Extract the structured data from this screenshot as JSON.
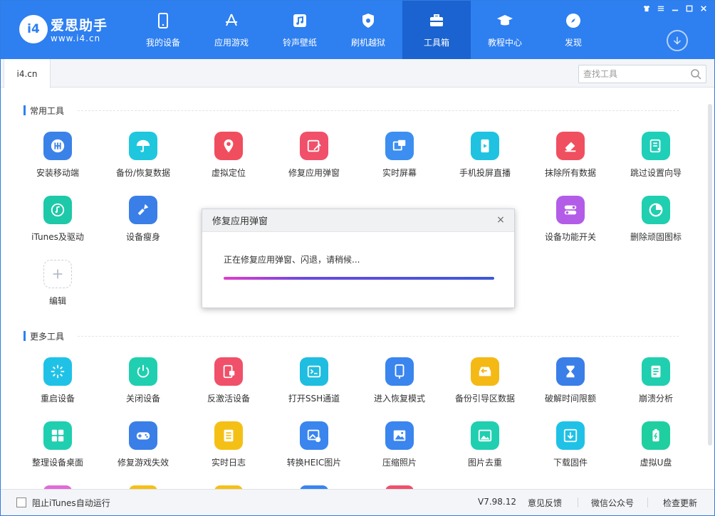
{
  "header": {
    "logo_text": "i4",
    "brand": "爱思助手",
    "url": "www.i4.cn",
    "nav": [
      {
        "label": "我的设备",
        "icon": "phone-icon"
      },
      {
        "label": "应用游戏",
        "icon": "appstore-icon"
      },
      {
        "label": "铃声壁纸",
        "icon": "music-icon"
      },
      {
        "label": "刷机越狱",
        "icon": "shield-icon"
      },
      {
        "label": "工具箱",
        "icon": "toolbox-icon",
        "active": true
      },
      {
        "label": "教程中心",
        "icon": "graduation-cap-icon"
      },
      {
        "label": "发现",
        "icon": "compass-icon"
      }
    ],
    "window_controls": [
      "tshirt-icon",
      "menu-icon",
      "minimize-icon",
      "maximize-icon",
      "close-icon"
    ]
  },
  "tabbar": {
    "tab_label": "i4.cn",
    "search_placeholder": "查找工具"
  },
  "sections": {
    "common_title": "常用工具",
    "more_title": "更多工具"
  },
  "common_tools": [
    {
      "label": "安装移动端",
      "icon": "i4-app-icon",
      "color": "#3b82e8"
    },
    {
      "label": "备份/恢复数据",
      "icon": "umbrella-icon",
      "color": "#1fc7de"
    },
    {
      "label": "虚拟定位",
      "icon": "location-pin-icon",
      "color": "#f04e5e"
    },
    {
      "label": "修复应用弹窗",
      "icon": "repair-app-icon",
      "color": "#f0506a"
    },
    {
      "label": "实时屏幕",
      "icon": "screen-mirror-icon",
      "color": "#3c8ef0"
    },
    {
      "label": "手机投屏直播",
      "icon": "phone-cast-icon",
      "color": "#1fc2e0"
    },
    {
      "label": "抹除所有数据",
      "icon": "eraser-icon",
      "color": "#f04f5f"
    },
    {
      "label": "跳过设置向导",
      "icon": "skip-setup-icon",
      "color": "#1fcfb8"
    },
    {
      "label": "iTunes及驱动",
      "icon": "itunes-icon",
      "color": "#1dc9a8"
    },
    {
      "label": "设备瘦身",
      "icon": "broom-icon",
      "color": "#3a7ee8"
    },
    {
      "label": "设备功能开关",
      "icon": "toggle-switch-icon",
      "color": "#b25ce8"
    },
    {
      "label": "删除顽固图标",
      "icon": "pie-chart-icon",
      "color": "#1fcfb0"
    },
    {
      "label": "编辑",
      "icon": "plus-icon",
      "color": "#ffffff"
    }
  ],
  "more_tools": [
    {
      "label": "重启设备",
      "icon": "restart-icon",
      "color": "#1fc2e6"
    },
    {
      "label": "关闭设备",
      "icon": "power-icon",
      "color": "#1fcfb0"
    },
    {
      "label": "反激活设备",
      "icon": "deactivate-icon",
      "color": "#f0506a"
    },
    {
      "label": "打开SSH通道",
      "icon": "terminal-icon",
      "color": "#1fbde0"
    },
    {
      "label": "进入恢复模式",
      "icon": "recovery-mode-icon",
      "color": "#3a85ee"
    },
    {
      "label": "备份引导区数据",
      "icon": "backup-boot-icon",
      "color": "#f5b915"
    },
    {
      "label": "破解时间限额",
      "icon": "hourglass-icon",
      "color": "#3a7ee8"
    },
    {
      "label": "崩溃分析",
      "icon": "crash-analysis-icon",
      "color": "#1fcfb0"
    },
    {
      "label": "整理设备桌面",
      "icon": "grid-icon",
      "color": "#1fcfb0"
    },
    {
      "label": "修复游戏失效",
      "icon": "gamepad-icon",
      "color": "#3a7ee8"
    },
    {
      "label": "实时日志",
      "icon": "log-icon",
      "color": "#f5c015"
    },
    {
      "label": "转换HEIC图片",
      "icon": "convert-image-icon",
      "color": "#3a85ee"
    },
    {
      "label": "压缩照片",
      "icon": "compress-photo-icon",
      "color": "#3a85ee"
    },
    {
      "label": "图片去重",
      "icon": "dedupe-image-icon",
      "color": "#1fcfb0"
    },
    {
      "label": "下载固件",
      "icon": "download-firmware-icon",
      "color": "#1fc2e6"
    },
    {
      "label": "虚拟U盘",
      "icon": "battery-usb-icon",
      "color": "#1fcfa0"
    }
  ],
  "modal": {
    "title": "修复应用弹窗",
    "message": "正在修复应用弹窗、闪退，请稍候...",
    "progress_fraction": 1.0
  },
  "footer": {
    "checkbox_label": "阻止iTunes自动运行",
    "checkbox_checked": false,
    "version": "V7.98.12",
    "feedback": "意见反馈",
    "wechat": "微信公众号",
    "update": "检查更新"
  }
}
